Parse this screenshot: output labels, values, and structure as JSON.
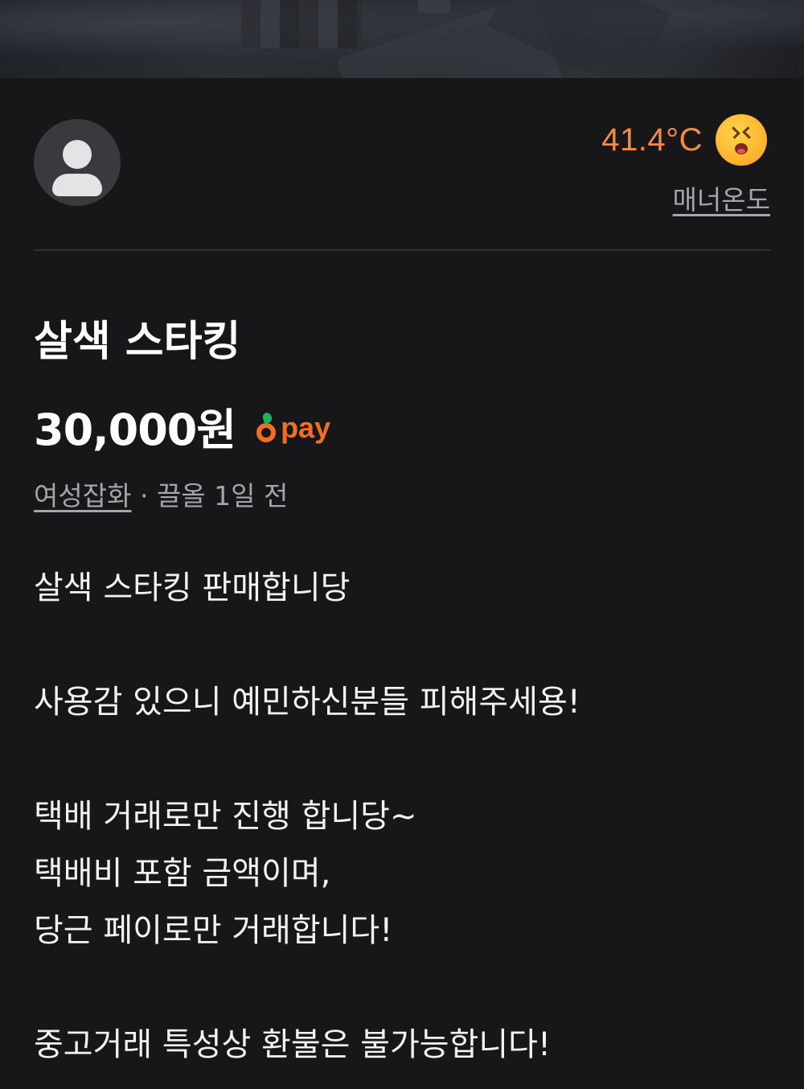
{
  "photo": {
    "alt": "product photo"
  },
  "seller": {
    "manner_temperature": "41.4°C",
    "manner_label": "매너온도"
  },
  "product": {
    "title": "살색 스타킹",
    "price": "30,000원",
    "pay_label": "pay",
    "category": "여성잡화",
    "meta_separator": " · ",
    "bumped": "끌올 1일 전"
  },
  "description": {
    "lines": [
      "살색 스타킹 판매합니당",
      "",
      "사용감 있으니 예민하신분들 피해주세용!",
      "",
      "택배 거래로만 진행 합니당~",
      "택배비 포함 금액이며,",
      "당근 페이로만 거래합니다!",
      "",
      "중고거래 특성상 환불은 불가능합니다!"
    ]
  },
  "colors": {
    "background": "#17171a",
    "accent_orange": "#f08c45",
    "pay_orange": "#f36d22",
    "secondary_text": "#a4a5aa"
  }
}
